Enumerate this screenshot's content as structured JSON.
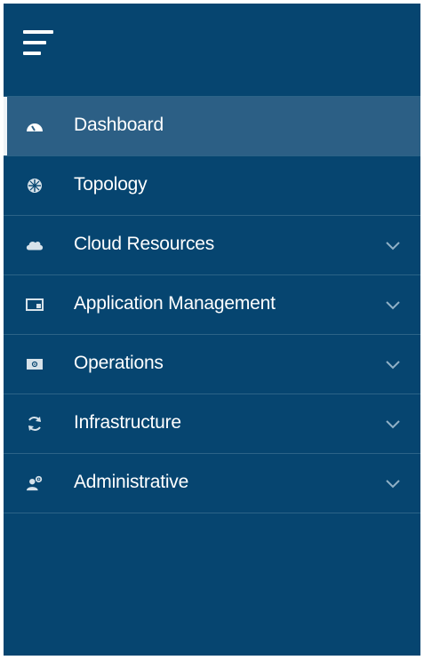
{
  "colors": {
    "sidebar_bg": "#064570",
    "active_bg": "#2c5f85",
    "divider": "#2c6387",
    "text": "#ffffff",
    "icon": "#d6e2ea",
    "chevron": "#8fb0c6"
  },
  "header": {
    "menu_icon": "hamburger-menu-icon"
  },
  "nav": {
    "items": [
      {
        "label": "Dashboard",
        "icon": "dashboard-gauge-icon",
        "active": true,
        "expandable": false
      },
      {
        "label": "Topology",
        "icon": "topology-globe-icon",
        "active": false,
        "expandable": false
      },
      {
        "label": "Cloud Resources",
        "icon": "cloud-icon",
        "active": false,
        "expandable": true
      },
      {
        "label": "Application Management",
        "icon": "application-window-icon",
        "active": false,
        "expandable": true
      },
      {
        "label": "Operations",
        "icon": "operations-panel-icon",
        "active": false,
        "expandable": true
      },
      {
        "label": "Infrastructure",
        "icon": "refresh-cycle-icon",
        "active": false,
        "expandable": true
      },
      {
        "label": "Administrative",
        "icon": "admin-user-gear-icon",
        "active": false,
        "expandable": true
      }
    ]
  }
}
